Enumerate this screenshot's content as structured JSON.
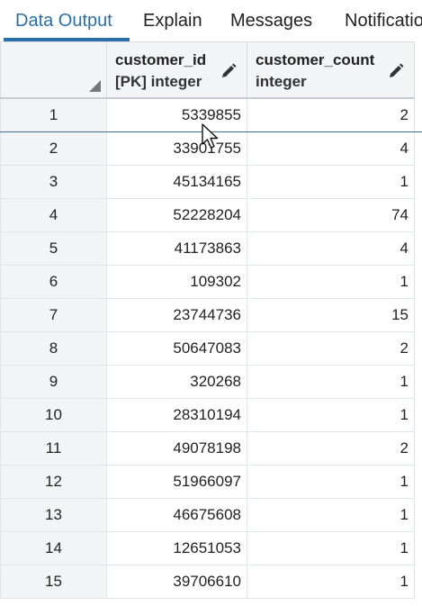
{
  "tabs": [
    {
      "label": "Data Output",
      "active": true
    },
    {
      "label": "Explain",
      "active": false
    },
    {
      "label": "Messages",
      "active": false
    },
    {
      "label": "Notifications",
      "active": false
    }
  ],
  "grid": {
    "columns": [
      {
        "name": "customer_id",
        "type": "[PK] integer",
        "icon": "pencil-icon"
      },
      {
        "name": "customer_count",
        "type": "integer",
        "icon": "pencil-icon"
      }
    ],
    "rows": [
      {
        "n": "1",
        "customer_id": "5339855",
        "customer_count": "2"
      },
      {
        "n": "2",
        "customer_id": "33901755",
        "customer_count": "4"
      },
      {
        "n": "3",
        "customer_id": "45134165",
        "customer_count": "1"
      },
      {
        "n": "4",
        "customer_id": "52228204",
        "customer_count": "74"
      },
      {
        "n": "5",
        "customer_id": "41173863",
        "customer_count": "4"
      },
      {
        "n": "6",
        "customer_id": "109302",
        "customer_count": "1"
      },
      {
        "n": "7",
        "customer_id": "23744736",
        "customer_count": "15"
      },
      {
        "n": "8",
        "customer_id": "50647083",
        "customer_count": "2"
      },
      {
        "n": "9",
        "customer_id": "320268",
        "customer_count": "1"
      },
      {
        "n": "10",
        "customer_id": "28310194",
        "customer_count": "1"
      },
      {
        "n": "11",
        "customer_id": "49078198",
        "customer_count": "2"
      },
      {
        "n": "12",
        "customer_id": "51966097",
        "customer_count": "1"
      },
      {
        "n": "13",
        "customer_id": "46675608",
        "customer_count": "1"
      },
      {
        "n": "14",
        "customer_id": "12651053",
        "customer_count": "1"
      },
      {
        "n": "15",
        "customer_id": "39706610",
        "customer_count": "1"
      }
    ]
  },
  "colors": {
    "accent": "#2c6fa6",
    "header_bg": "#f3f4f6",
    "selected_row_border": "#3b6e99"
  }
}
